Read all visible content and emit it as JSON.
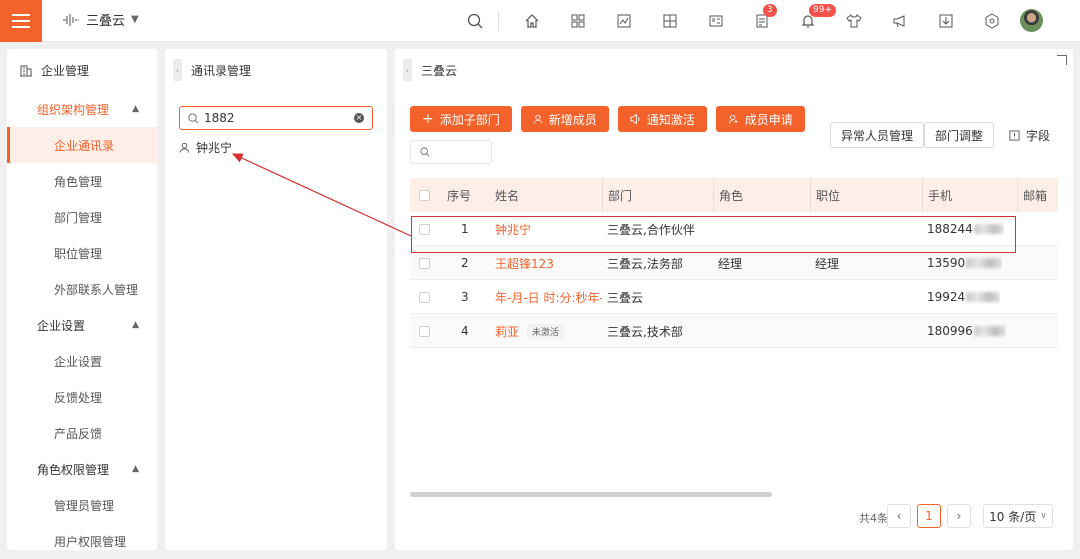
{
  "topbar": {
    "brand": "三叠云",
    "notification_badges": {
      "tasks": "3",
      "bell": "99+"
    }
  },
  "sidebar": {
    "header": "企业管理",
    "groups": [
      {
        "label": "组织架构管理",
        "items": [
          "企业通讯录",
          "角色管理",
          "部门管理",
          "职位管理",
          "外部联系人管理"
        ]
      },
      {
        "label": "企业设置",
        "items": [
          "企业设置",
          "反馈处理",
          "产品反馈"
        ]
      },
      {
        "label": "角色权限管理",
        "items": [
          "管理员管理",
          "用户权限管理"
        ]
      }
    ],
    "active_item": "企业通讯录"
  },
  "directory": {
    "title": "通讯录管理",
    "search_value": "1882",
    "result": "钟兆宁"
  },
  "main": {
    "breadcrumb": "三叠云",
    "buttons": {
      "add_sub_dept": "添加子部门",
      "add_member": "新增成员",
      "notify_activate": "通知激活",
      "member_apply": "成员申请",
      "abnormal": "异常人员管理",
      "dept_adjust": "部门调整",
      "fields": "字段"
    },
    "table": {
      "columns": [
        "序号",
        "姓名",
        "部门",
        "角色",
        "职位",
        "手机",
        "邮箱"
      ],
      "rows": [
        {
          "no": "1",
          "name": "钟兆宁",
          "dept": "三叠云,合作伙伴",
          "role": "",
          "position": "",
          "phone": "188244",
          "tag": ""
        },
        {
          "no": "2",
          "name": "王超锋123",
          "dept": "三叠云,法务部",
          "role": "经理",
          "position": "经理",
          "phone": "13590",
          "tag": ""
        },
        {
          "no": "3",
          "name": "年-月-日 时:分:秒年-...",
          "dept": "三叠云",
          "role": "",
          "position": "",
          "phone": "19924",
          "tag": ""
        },
        {
          "no": "4",
          "name": "莉亚",
          "dept": "三叠云,技术部",
          "role": "",
          "position": "",
          "phone": "180996",
          "tag": "未激活"
        }
      ]
    },
    "pagination": {
      "total": "共4条",
      "current_page": "1",
      "page_size": "10 条/页"
    }
  },
  "colors": {
    "accent": "#f4622b",
    "annotation": "#d63030"
  }
}
